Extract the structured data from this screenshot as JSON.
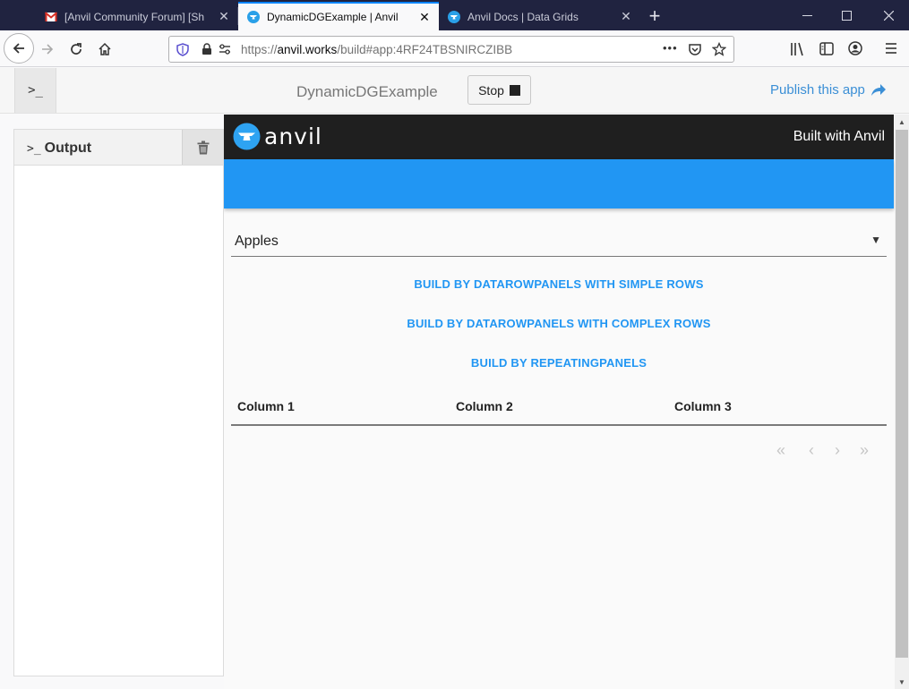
{
  "browser": {
    "tabs": [
      {
        "title": "[Anvil Community Forum] [Sh",
        "icon": "gmail-icon"
      },
      {
        "title": "DynamicDGExample | Anvil",
        "icon": "anvil-icon"
      },
      {
        "title": "Anvil Docs | Data Grids",
        "icon": "anvil-icon"
      }
    ],
    "url": {
      "prefix": "https://",
      "host": "anvil.works",
      "path": "/build#app:4RF24TBSNIRCZIBB"
    },
    "url_menu": "•••"
  },
  "anvil_toolbar": {
    "terminal_glyph": ">_",
    "app_name": "DynamicDGExample",
    "stop_label": "Stop",
    "publish_label": "Publish this app"
  },
  "output": {
    "prompt": ">_",
    "title": "Output"
  },
  "app": {
    "logo_text": "anvil",
    "built_with": "Built with Anvil",
    "dropdown_value": "Apples",
    "buttons": [
      "BUILD BY DATAROWPANELS WITH SIMPLE ROWS",
      "BUILD BY DATAROWPANELS WITH COMPLEX ROWS",
      "BUILD BY REPEATINGPANELS"
    ],
    "columns": [
      "Column 1",
      "Column 2",
      "Column 3"
    ],
    "pager": {
      "first": "«",
      "prev": "‹",
      "next": "›",
      "last": "»"
    }
  },
  "colors": {
    "accent": "#2196f3",
    "tabstrip": "#202340",
    "header": "#1f1f1f"
  }
}
